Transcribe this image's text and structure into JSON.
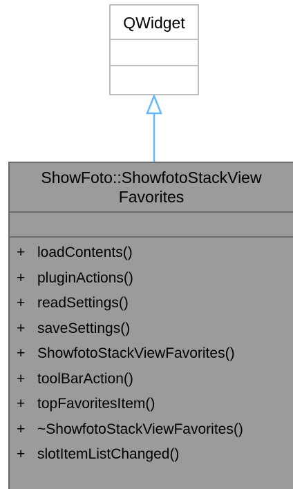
{
  "base_class": {
    "name": "QWidget"
  },
  "derived_class": {
    "name_line1": "ShowFoto::ShowfotoStackView",
    "name_line2": "Favorites",
    "members": [
      {
        "visibility": "+",
        "name": "loadContents()"
      },
      {
        "visibility": "+",
        "name": "pluginActions()"
      },
      {
        "visibility": "+",
        "name": "readSettings()"
      },
      {
        "visibility": "+",
        "name": "saveSettings()"
      },
      {
        "visibility": "+",
        "name": "ShowfotoStackViewFavorites()"
      },
      {
        "visibility": "+",
        "name": "toolBarAction()"
      },
      {
        "visibility": "+",
        "name": "topFavoritesItem()"
      },
      {
        "visibility": "+",
        "name": "~ShowfotoStackViewFavorites()"
      },
      {
        "visibility": "+",
        "name": "slotItemListChanged()"
      }
    ]
  },
  "colors": {
    "base_border": "#bdbdbd",
    "derived_fill": "#9b9b9b",
    "derived_border": "#6b6b6b",
    "arrow": "#63b8ff"
  }
}
